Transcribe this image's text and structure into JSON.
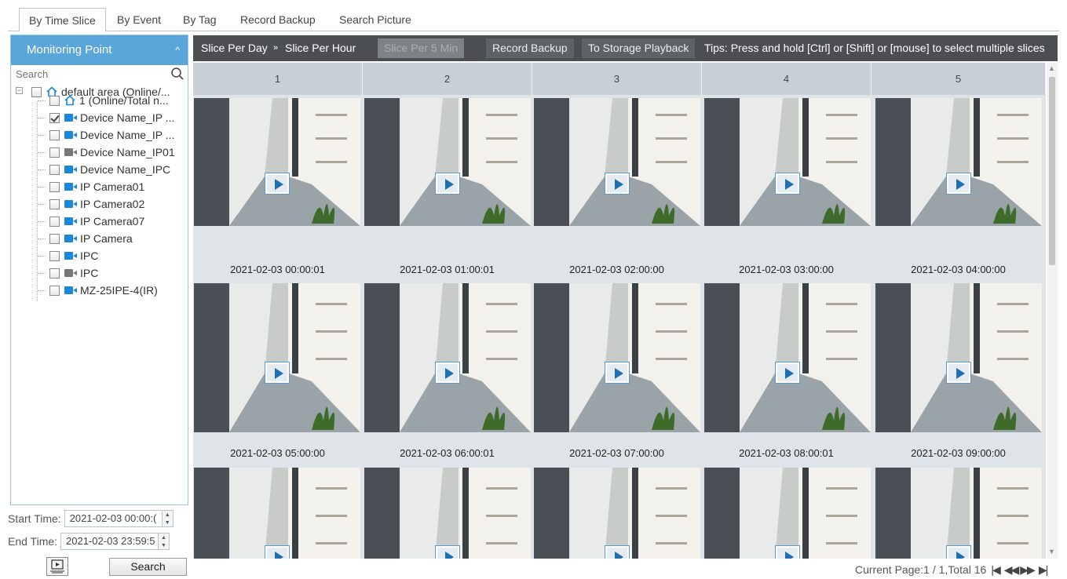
{
  "tabs": [
    {
      "label": "By Time Slice",
      "active": true
    },
    {
      "label": "By Event",
      "active": false
    },
    {
      "label": "By Tag",
      "active": false
    },
    {
      "label": "Record Backup",
      "active": false
    },
    {
      "label": "Search Picture",
      "active": false
    }
  ],
  "sidebar": {
    "title": "Monitoring Point",
    "search_placeholder": "Search",
    "tree": [
      {
        "label": "default area (Online/...",
        "icon": "house-icon",
        "checked": false
      },
      {
        "label": "1 (Online/Total n...",
        "icon": "house-icon",
        "checked": false
      },
      {
        "label": "Device Name_IP ...",
        "icon": "camera-icon",
        "online": true,
        "checked": true
      },
      {
        "label": "Device Name_IP ...",
        "icon": "camera-icon",
        "online": true,
        "checked": false
      },
      {
        "label": "Device Name_IP01",
        "icon": "camera-icon",
        "online": false,
        "checked": false
      },
      {
        "label": "Device Name_IPC",
        "icon": "camera-icon",
        "online": true,
        "checked": false
      },
      {
        "label": "IP Camera01",
        "icon": "camera-icon",
        "online": true,
        "checked": false
      },
      {
        "label": "IP Camera02",
        "icon": "camera-icon",
        "online": true,
        "checked": false
      },
      {
        "label": "IP Camera07",
        "icon": "camera-icon",
        "online": true,
        "checked": false
      },
      {
        "label": "IP Camera",
        "icon": "camera-icon",
        "online": true,
        "checked": false
      },
      {
        "label": "IPC",
        "icon": "camera-icon",
        "online": true,
        "checked": false
      },
      {
        "label": "IPC",
        "icon": "camera-icon",
        "online": false,
        "checked": false
      },
      {
        "label": "MZ-25IPE-4(IR)",
        "icon": "camera-icon",
        "online": true,
        "checked": false
      }
    ],
    "start_time_label": "Start Time:",
    "start_time_value": "2021-02-03 00:00:(",
    "end_time_label": "End Time:",
    "end_time_value": "2021-02-03 23:59:5",
    "search_button": "Search"
  },
  "toolbar": {
    "slice_per_day": "Slice Per Day",
    "separator": "»",
    "slice_per_hour": "Slice Per Hour",
    "slice_per_5min": "Slice Per 5 Min",
    "record_backup": "Record Backup",
    "storage_playback": "To Storage Playback",
    "tips": "Tips: Press and hold [Ctrl] or [Shift] or [mouse] to select multiple slices"
  },
  "grid": {
    "columns": [
      "1",
      "2",
      "3",
      "4",
      "5"
    ],
    "rows": [
      [
        "2021-02-03 00:00:01",
        "2021-02-03 01:00:01",
        "2021-02-03 02:00:00",
        "2021-02-03 03:00:00",
        "2021-02-03 04:00:00"
      ],
      [
        "2021-02-03 05:00:00",
        "2021-02-03 06:00:01",
        "2021-02-03 07:00:00",
        "2021-02-03 08:00:01",
        "2021-02-03 09:00:00"
      ],
      [
        "",
        "",
        "",
        "",
        ""
      ]
    ]
  },
  "pager": {
    "text": "Current Page:1 / 1,Total 16",
    "first": "|◀",
    "prev": "◀◀",
    "next": "▶▶",
    "last": "▶|"
  },
  "colors": {
    "accent": "#5ba6d9",
    "toolbar_bg": "#4c4f52",
    "grid_bg": "#dfe4e8",
    "camera_online": "#1a88d8",
    "camera_offline": "#777777"
  }
}
